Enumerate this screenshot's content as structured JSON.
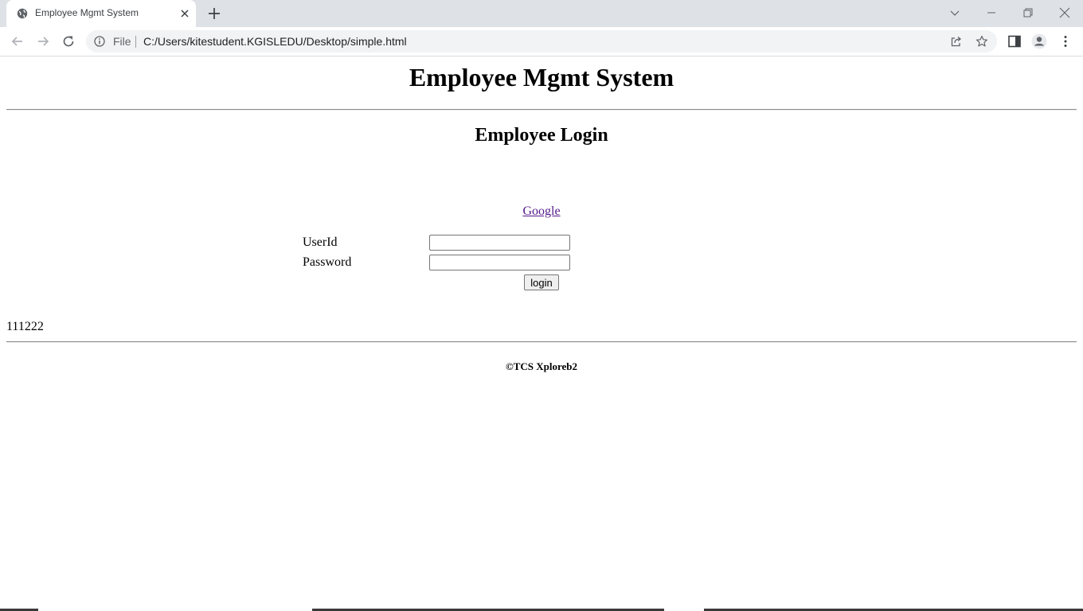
{
  "browser": {
    "tab_title": "Employee Mgmt System",
    "omnibox_scheme": "File",
    "url": "C:/Users/kitestudent.KGISLEDU/Desktop/simple.html"
  },
  "page": {
    "heading": "Employee Mgmt System",
    "subheading": "Employee Login",
    "link_text": "Google",
    "userid_label": "UserId",
    "password_label": "Password",
    "userid_value": "",
    "password_value": "",
    "login_label": "login",
    "numeric_text": "111222",
    "footer": "©TCS Xploreb2"
  },
  "icons": {
    "favicon": "globe-icon",
    "tab_close": "close-icon",
    "new_tab": "plus-icon",
    "tab_search": "chevron-down-icon",
    "minimize": "minimize-icon",
    "restore": "restore-icon",
    "close_window": "close-icon",
    "back": "arrow-left-icon",
    "forward": "arrow-right-icon",
    "reload": "reload-icon",
    "site_info": "info-icon",
    "share": "share-icon",
    "bookmark": "star-icon",
    "side_panel": "side-panel-icon",
    "profile": "profile-icon",
    "menu": "kebab-menu-icon"
  }
}
